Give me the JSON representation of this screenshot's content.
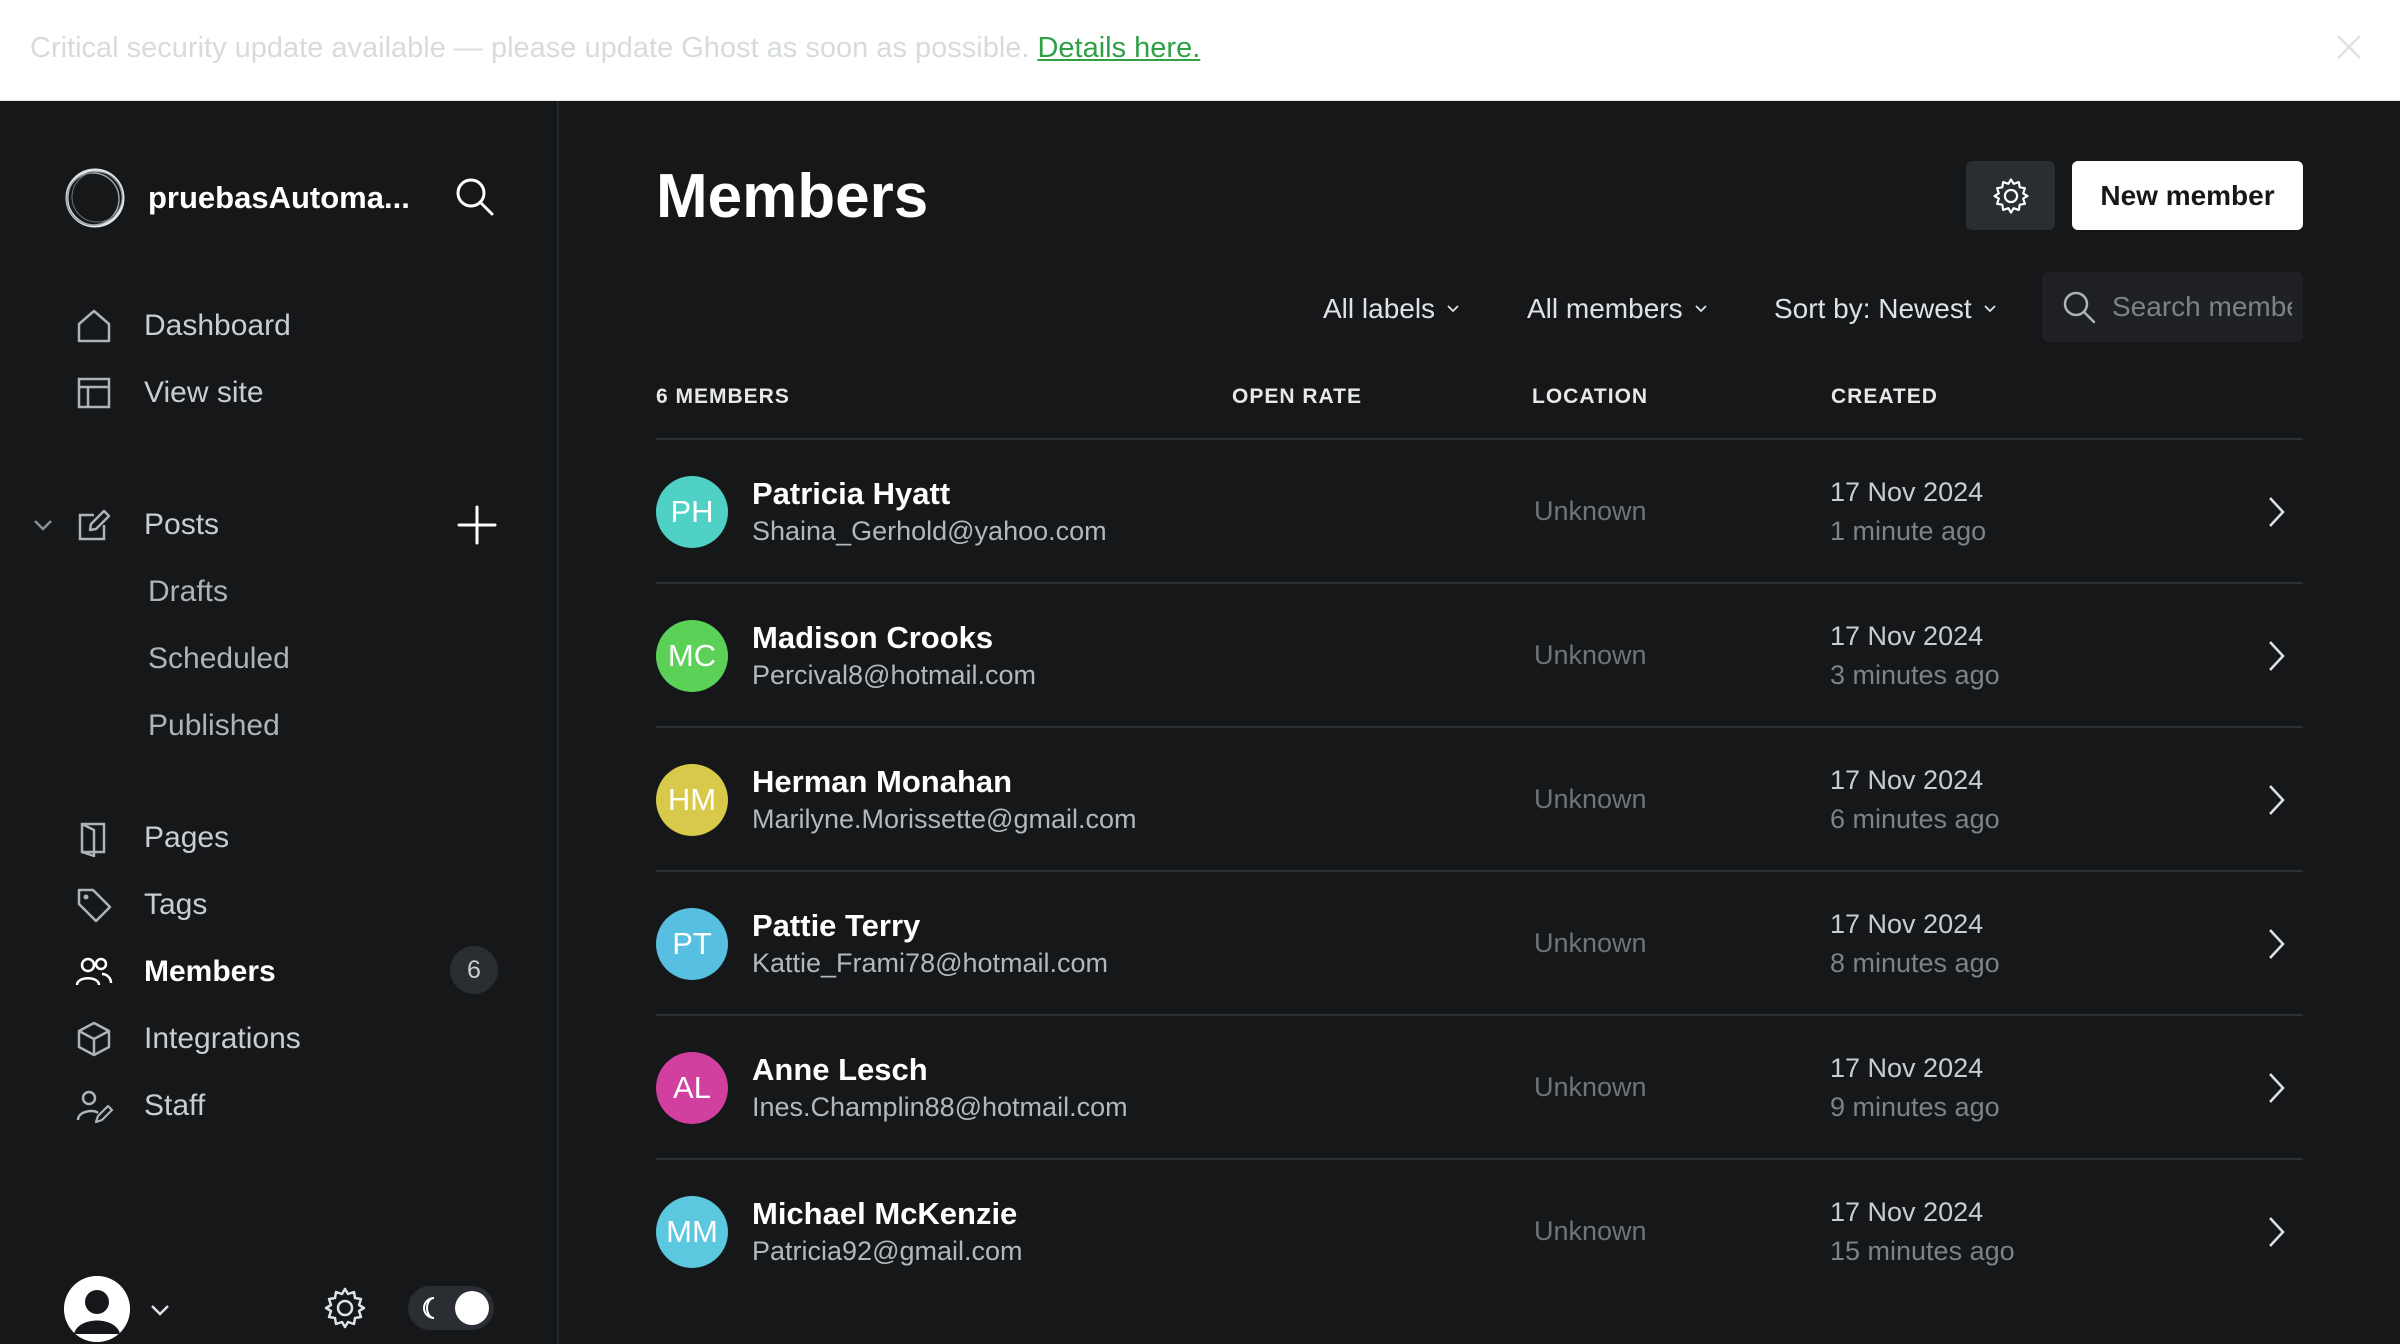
{
  "banner": {
    "message": "Critical security update available — please update Ghost as soon as possible.",
    "link": "Details here."
  },
  "sidebar": {
    "site_name": "pruebasAutoma...",
    "items": [
      {
        "label": "Dashboard",
        "icon": "home-icon"
      },
      {
        "label": "View site",
        "icon": "layout-icon"
      },
      {
        "label": "Posts",
        "icon": "edit-icon"
      },
      {
        "label": "Pages",
        "icon": "page-icon"
      },
      {
        "label": "Tags",
        "icon": "tag-icon"
      },
      {
        "label": "Members",
        "icon": "members-icon",
        "active": true,
        "count": "6"
      },
      {
        "label": "Integrations",
        "icon": "box-icon"
      },
      {
        "label": "Staff",
        "icon": "staff-icon"
      }
    ],
    "posts_subitems": [
      "Drafts",
      "Scheduled",
      "Published"
    ]
  },
  "main": {
    "title": "Members",
    "new_member_label": "New member",
    "filters": {
      "labels": "All labels",
      "members": "All members",
      "sort": "Sort by: Newest"
    },
    "search": {
      "placeholder": "Search members..."
    },
    "columns": {
      "members": "6 MEMBERS",
      "open_rate": "OPEN RATE",
      "location": "LOCATION",
      "created": "CREATED"
    },
    "members": [
      {
        "initials": "PH",
        "name": "Patricia Hyatt",
        "email": "Shaina_Gerhold@yahoo.com",
        "location": "Unknown",
        "date": "17 Nov 2024",
        "ago": "1 minute ago",
        "color": "#4fd1c5"
      },
      {
        "initials": "MC",
        "name": "Madison Crooks",
        "email": "Percival8@hotmail.com",
        "location": "Unknown",
        "date": "17 Nov 2024",
        "ago": "3 minutes ago",
        "color": "#5bd157"
      },
      {
        "initials": "HM",
        "name": "Herman Monahan",
        "email": "Marilyne.Morissette@gmail.com",
        "location": "Unknown",
        "date": "17 Nov 2024",
        "ago": "6 minutes ago",
        "color": "#d9c94a"
      },
      {
        "initials": "PT",
        "name": "Pattie Terry",
        "email": "Kattie_Frami78@hotmail.com",
        "location": "Unknown",
        "date": "17 Nov 2024",
        "ago": "8 minutes ago",
        "color": "#57bfdf"
      },
      {
        "initials": "AL",
        "name": "Anne Lesch",
        "email": "Ines.Champlin88@hotmail.com",
        "location": "Unknown",
        "date": "17 Nov 2024",
        "ago": "9 minutes ago",
        "color": "#d13f9f"
      },
      {
        "initials": "MM",
        "name": "Michael McKenzie",
        "email": "Patricia92@gmail.com",
        "location": "Unknown",
        "date": "17 Nov 2024",
        "ago": "15 minutes ago",
        "color": "#5bc8df"
      }
    ]
  }
}
